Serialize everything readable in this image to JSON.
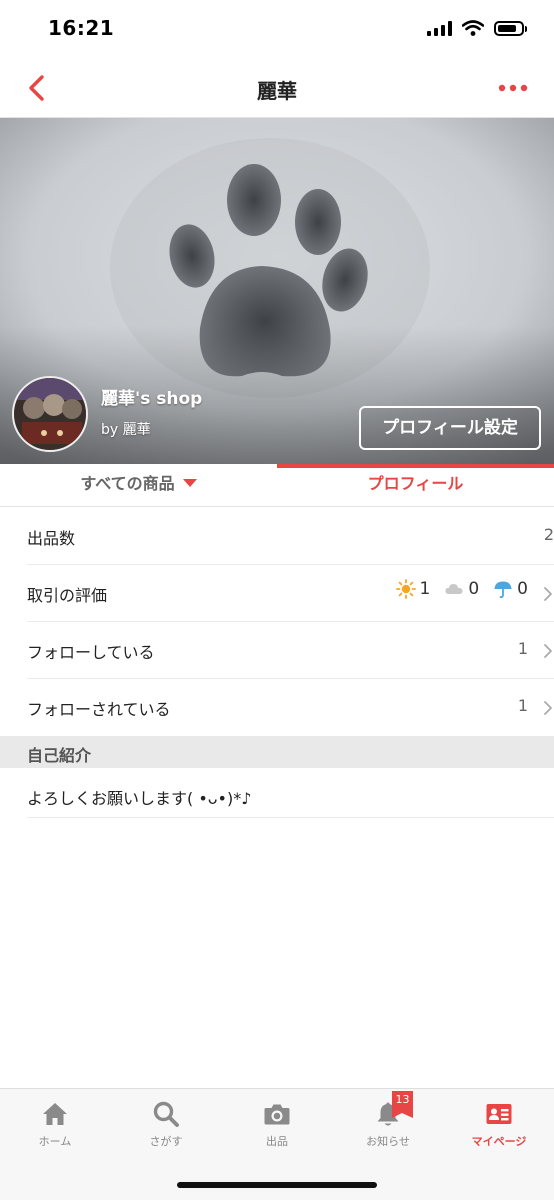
{
  "status_bar": {
    "time": "16:21"
  },
  "nav": {
    "title": "麗華"
  },
  "cover": {
    "shop_name": "麗華's shop",
    "by_line": "by 麗華",
    "profile_button": "プロフィール設定"
  },
  "tabs": [
    {
      "label": "すべての商品",
      "active": false
    },
    {
      "label": "プロフィール",
      "active": true
    }
  ],
  "rows": {
    "listings": {
      "label": "出品数",
      "value": "2"
    },
    "ratings": {
      "label": "取引の評価",
      "good": "1",
      "normal": "0",
      "bad": "0"
    },
    "following": {
      "label": "フォローしている",
      "value": "1"
    },
    "followers": {
      "label": "フォローされている",
      "value": "1"
    }
  },
  "intro": {
    "heading": "自己紹介",
    "text": "よろしくお願いします( •ᴗ•)*♪"
  },
  "tabbar": {
    "items": [
      {
        "label": "ホーム",
        "icon": "home-icon"
      },
      {
        "label": "さがす",
        "icon": "search-icon"
      },
      {
        "label": "出品",
        "icon": "camera-icon"
      },
      {
        "label": "お知らせ",
        "icon": "bell-icon",
        "badge": "13"
      },
      {
        "label": "マイページ",
        "icon": "profile-card-icon",
        "active": true
      }
    ]
  },
  "colors": {
    "accent": "#e84545",
    "sun": "#f5a623",
    "cloud": "#c8c8c8",
    "umbrella": "#4da6e0"
  }
}
